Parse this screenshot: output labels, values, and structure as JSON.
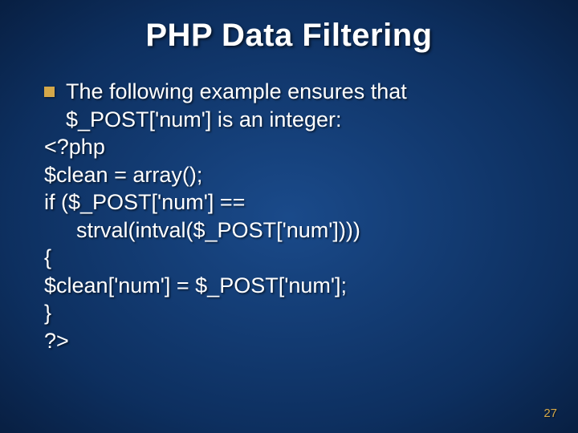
{
  "title": "PHP Data Filtering",
  "bullet": "The following example ensures that $_POST['num'] is an integer:",
  "code": {
    "l1": "<?php",
    "l2": "$clean = array();",
    "l3": " if ($_POST['num'] ==",
    "l4": "strval(intval($_POST['num'])))",
    "l5": "{",
    "l6": " $clean['num'] = $_POST['num'];",
    "l7": "}",
    "l8": "?>"
  },
  "page_number": "27"
}
